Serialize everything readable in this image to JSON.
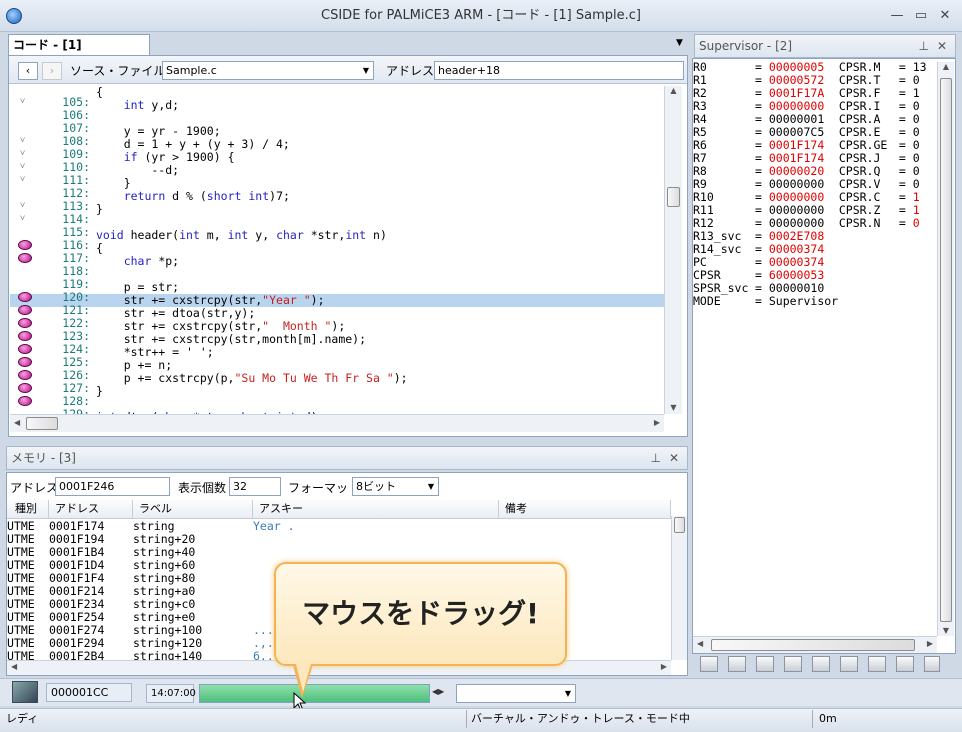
{
  "window": {
    "title": "CSIDE for PALMiCE3 ARM - [コード - [1] Sample.c]"
  },
  "editor": {
    "tab_label": "コード - [1] Sample.c",
    "source_file_label": "ソース・ファイル",
    "source_file_value": "Sample.c",
    "address_label": "アドレス",
    "address_value": "header+18",
    "lines": [
      {
        "num": "105:",
        "text": "{",
        "fold": "˅",
        "bp": false,
        "hl": false
      },
      {
        "num": "106:",
        "text": "    int y,d;",
        "fold": "",
        "bp": false,
        "hl": false
      },
      {
        "num": "107:",
        "text": "",
        "fold": "",
        "bp": false,
        "hl": false
      },
      {
        "num": "108:",
        "text": "    y = yr - 1900;",
        "fold": "˅",
        "bp": false,
        "hl": false
      },
      {
        "num": "109:",
        "text": "    d = 1 + y + (y + 3) / 4;",
        "fold": "˅",
        "bp": false,
        "hl": false
      },
      {
        "num": "110:",
        "text": "    if (yr > 1900) {",
        "fold": "˅",
        "bp": false,
        "hl": false
      },
      {
        "num": "111:",
        "text": "        --d;",
        "fold": "˅",
        "bp": false,
        "hl": false
      },
      {
        "num": "112:",
        "text": "    }",
        "fold": "",
        "bp": false,
        "hl": false
      },
      {
        "num": "113:",
        "text": "    return d % (short int)7;",
        "fold": "˅",
        "bp": false,
        "hl": false
      },
      {
        "num": "114:",
        "text": "}",
        "fold": "˅",
        "bp": false,
        "hl": false
      },
      {
        "num": "115:",
        "text": "",
        "fold": "",
        "bp": false,
        "hl": false
      },
      {
        "num": "116:",
        "text": "void header(int m, int y, char *str,int n)",
        "fold": "",
        "bp": true,
        "hl": false
      },
      {
        "num": "117:",
        "text": "{",
        "fold": "",
        "bp": true,
        "hl": false
      },
      {
        "num": "118:",
        "text": "    char *p;",
        "fold": "",
        "bp": false,
        "hl": false
      },
      {
        "num": "119:",
        "text": "",
        "fold": "",
        "bp": false,
        "hl": false
      },
      {
        "num": "120:",
        "text": "    p = str;",
        "fold": "",
        "bp": true,
        "hl": false
      },
      {
        "num": "121:",
        "text": "    str += cxstrcpy(str,\"Year \");",
        "fold": "",
        "bp": true,
        "hl": true
      },
      {
        "num": "122:",
        "text": "    str += dtoa(str,y);",
        "fold": "",
        "bp": true,
        "hl": false
      },
      {
        "num": "123:",
        "text": "    str += cxstrcpy(str,\"  Month \");",
        "fold": "",
        "bp": true,
        "hl": false
      },
      {
        "num": "124:",
        "text": "    str += cxstrcpy(str,month[m].name);",
        "fold": "",
        "bp": true,
        "hl": false
      },
      {
        "num": "125:",
        "text": "    *str++ = ' ';",
        "fold": "",
        "bp": true,
        "hl": false
      },
      {
        "num": "126:",
        "text": "    p += n;",
        "fold": "",
        "bp": true,
        "hl": false
      },
      {
        "num": "127:",
        "text": "    p += cxstrcpy(p,\"Su Mo Tu We Th Fr Sa \");",
        "fold": "",
        "bp": true,
        "hl": false
      },
      {
        "num": "128:",
        "text": "}",
        "fold": "",
        "bp": true,
        "hl": false
      },
      {
        "num": "129:",
        "text": "",
        "fold": "",
        "bp": false,
        "hl": false
      },
      {
        "num": "130:",
        "text": "int dtoa(char *str, short int d)",
        "fold": "˅",
        "bp": false,
        "hl": false
      }
    ]
  },
  "supervisor": {
    "title": "Supervisor - [2]",
    "rows": [
      {
        "reg": "R0",
        "val": "00000005",
        "red": true,
        "flag": "CPSR.M",
        "fval": "13",
        "fred": false
      },
      {
        "reg": "R1",
        "val": "00000572",
        "red": true,
        "flag": "CPSR.T",
        "fval": "0",
        "fred": false
      },
      {
        "reg": "R2",
        "val": "0001F17A",
        "red": true,
        "flag": "CPSR.F",
        "fval": "1",
        "fred": false
      },
      {
        "reg": "R3",
        "val": "00000000",
        "red": true,
        "flag": "CPSR.I",
        "fval": "0",
        "fred": false
      },
      {
        "reg": "R4",
        "val": "00000001",
        "red": false,
        "flag": "CPSR.A",
        "fval": "0",
        "fred": false
      },
      {
        "reg": "R5",
        "val": "000007C5",
        "red": false,
        "flag": "CPSR.E",
        "fval": "0",
        "fred": false
      },
      {
        "reg": "R6",
        "val": "0001F174",
        "red": true,
        "flag": "CPSR.GE",
        "fval": "0",
        "fred": false
      },
      {
        "reg": "R7",
        "val": "0001F174",
        "red": true,
        "flag": "CPSR.J",
        "fval": "0",
        "fred": false
      },
      {
        "reg": "R8",
        "val": "00000020",
        "red": true,
        "flag": "CPSR.Q",
        "fval": "0",
        "fred": false
      },
      {
        "reg": "R9",
        "val": "00000000",
        "red": false,
        "flag": "CPSR.V",
        "fval": "0",
        "fred": false
      },
      {
        "reg": "R10",
        "val": "00000000",
        "red": true,
        "flag": "CPSR.C",
        "fval": "1",
        "fred": true
      },
      {
        "reg": "R11",
        "val": "00000000",
        "red": false,
        "flag": "CPSR.Z",
        "fval": "1",
        "fred": true
      },
      {
        "reg": "R12",
        "val": "00000000",
        "red": false,
        "flag": "CPSR.N",
        "fval": "0",
        "fred": true
      },
      {
        "reg": "R13_svc",
        "val": "0002E708",
        "red": true,
        "flag": "",
        "fval": "",
        "fred": false
      },
      {
        "reg": "R14_svc",
        "val": "00000374",
        "red": true,
        "flag": "",
        "fval": "",
        "fred": false
      },
      {
        "reg": "PC",
        "val": "00000374",
        "red": true,
        "flag": "",
        "fval": "",
        "fred": false
      },
      {
        "reg": "CPSR",
        "val": "60000053",
        "red": true,
        "flag": "",
        "fval": "",
        "fred": false
      },
      {
        "reg": "SPSR_svc",
        "val": "00000010",
        "red": false,
        "flag": "",
        "fval": "",
        "fred": false
      },
      {
        "reg": "MODE",
        "val": "Supervisor",
        "red": false,
        "flag": "",
        "fval": "",
        "fred": false
      }
    ]
  },
  "memory": {
    "title": "メモリ - [3]",
    "address_label": "アドレス",
    "address_value": "0001F246",
    "count_label": "表示個数",
    "count_value": "32",
    "format_label": "フォーマット",
    "format_value": "8ビット",
    "columns": [
      "種別",
      "アドレス",
      "ラベル",
      "アスキー",
      "備考"
    ],
    "rows": [
      {
        "kind": "UTME",
        "addr": "0001F174",
        "label": "string",
        "ascii": "Year ."
      },
      {
        "kind": "UTME",
        "addr": "0001F194",
        "label": "string+20",
        "ascii": ""
      },
      {
        "kind": "UTME",
        "addr": "0001F1B4",
        "label": "string+40",
        "ascii": ""
      },
      {
        "kind": "UTME",
        "addr": "0001F1D4",
        "label": "string+60",
        "ascii": ""
      },
      {
        "kind": "UTME",
        "addr": "0001F1F4",
        "label": "string+80",
        "ascii": ""
      },
      {
        "kind": "UTME",
        "addr": "0001F214",
        "label": "string+a0",
        "ascii": ""
      },
      {
        "kind": "UTME",
        "addr": "0001F234",
        "label": "string+c0",
        "ascii": ""
      },
      {
        "kind": "UTME",
        "addr": "0001F254",
        "label": "string+e0",
        "ascii": ""
      },
      {
        "kind": "UTME",
        "addr": "0001F274",
        "label": "string+100",
        "ascii": "..."
      },
      {
        "kind": "UTME",
        "addr": "0001F294",
        "label": "string+120",
        "ascii": ".,."
      },
      {
        "kind": "UTME",
        "addr": "0001F2B4",
        "label": "string+140",
        "ascii": "6.."
      }
    ]
  },
  "trace": {
    "address": "000001CC",
    "time": "14:07:00",
    "progress": 1.0
  },
  "callout": {
    "text": "マウスをドラッグ!"
  },
  "status": {
    "left": "レディ",
    "mode": "バーチャル・アンドゥ・トレース・モード中",
    "time": "0m"
  },
  "colors": {
    "highlight": "#b9d4ee",
    "changed": "#e00000",
    "progress": "#5cd08a",
    "callout_border": "#f3b256"
  }
}
